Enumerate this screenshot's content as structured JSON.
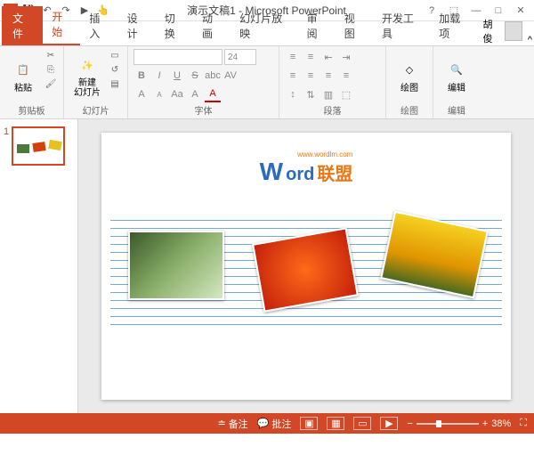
{
  "title": "演示文稿1 - Microsoft PowerPoint",
  "qat": {
    "save": "💾",
    "undo": "↶",
    "redo": "↷",
    "start": "▶",
    "touch": "👆"
  },
  "win": {
    "help": "?",
    "opts": "⬚",
    "min": "—",
    "max": "□",
    "close": "✕",
    "ribmin": "^"
  },
  "tabs": {
    "file": "文件",
    "home": "开始",
    "insert": "插入",
    "design": "设计",
    "trans": "切换",
    "anim": "动画",
    "show": "幻灯片放映",
    "review": "审阅",
    "view": "视图",
    "dev": "开发工具",
    "addin": "加载项"
  },
  "user": {
    "name": "胡俊"
  },
  "groups": {
    "clipboard": "剪贴板",
    "slides": "幻灯片",
    "font": "字体",
    "para": "段落",
    "draw": "绘图",
    "edit": "编辑"
  },
  "btn": {
    "paste": "粘贴",
    "newslide": "新建\n幻灯片",
    "draw": "绘图",
    "edit": "编辑"
  },
  "font": {
    "size": "24",
    "bold": "B",
    "italic": "I",
    "under": "U",
    "strike": "S",
    "shadow": "abc",
    "space": "AV",
    "case": "Aa",
    "clear": "A",
    "color": "A",
    "size_up": "A",
    "size_dn": "A"
  },
  "slide": {
    "num": "1",
    "logo_w": "W",
    "logo_ord": "ord",
    "logo_cn": "联盟",
    "logo_url": "www.wordlm.com"
  },
  "status": {
    "notes": "备注",
    "comments": "批注",
    "zoom": "38%",
    "minus": "−",
    "plus": "+",
    "fit": "⛶"
  }
}
